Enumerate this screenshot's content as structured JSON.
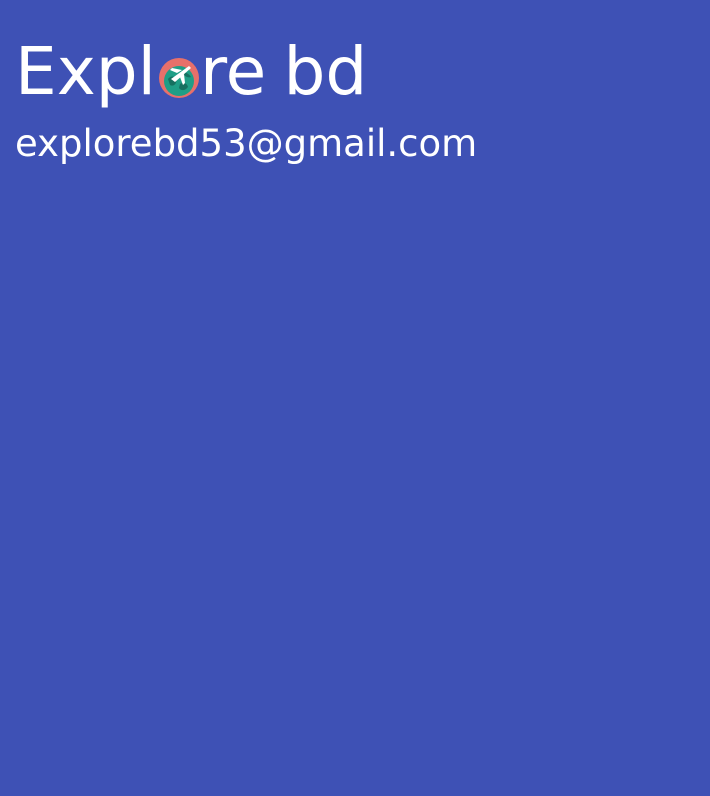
{
  "brand": {
    "text_before_icon": "Expl",
    "text_after_icon": "re",
    "text_last_word": "bd",
    "icon": "globe-airplane-icon",
    "icon_colors": {
      "ring": "#e8706a",
      "globe": "#1f9e86",
      "land": "#167060",
      "plane": "#ffffff"
    }
  },
  "contact": {
    "email": "explorebd53@gmail.com"
  },
  "colors": {
    "background": "#3e51b5",
    "text": "#ffffff"
  }
}
